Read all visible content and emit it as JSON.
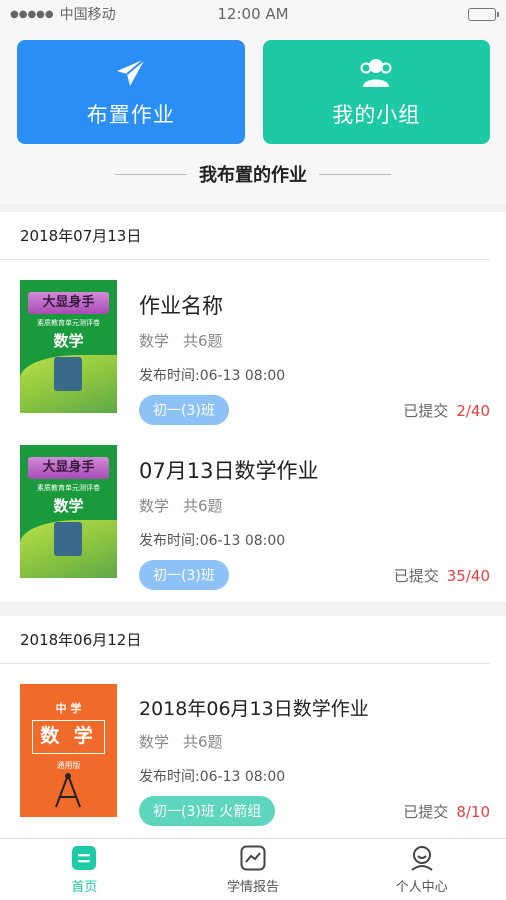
{
  "status_bar": {
    "signal": "●●●●●",
    "carrier": "中国移动",
    "time": "12:00 AM"
  },
  "actions": [
    {
      "label": "布置作业",
      "icon": "paper-plane-icon",
      "color": "#2a8ef5"
    },
    {
      "label": "我的小组",
      "icon": "group-icon",
      "color": "#1ec9a6"
    }
  ],
  "section_title": "我布置的作业",
  "groups": [
    {
      "date": "2018年07月13日",
      "items": [
        {
          "cover": {
            "title": "大显身手",
            "sub": "素质教育单元测评卷",
            "subject": "数学"
          },
          "name": "作业名称",
          "subject": "数学",
          "count": "共6题",
          "publish_time": "发布时间:06-13 08:00",
          "class_tag": "初一(3)班",
          "submitted_label": "已提交",
          "submitted": "2/40"
        },
        {
          "cover": {
            "title": "大显身手",
            "sub": "素质教育单元测评卷",
            "subject": "数学"
          },
          "name": "07月13日数学作业",
          "subject": "数学",
          "count": "共6题",
          "publish_time": "发布时间:06-13 08:00",
          "class_tag": "初一(3)班",
          "submitted_label": "已提交",
          "submitted": "35/40"
        }
      ]
    },
    {
      "date": "2018年06月12日",
      "items": [
        {
          "cover": {
            "top": "中 学",
            "subject": "数 学",
            "edition": "通用版"
          },
          "name": "2018年06月13日数学作业",
          "subject": "数学",
          "count": "共6题",
          "publish_time": "发布时间:06-13 08:00",
          "class_tag": "初一(3)班 火箭组",
          "submitted_label": "已提交",
          "submitted": "8/10"
        }
      ]
    }
  ],
  "tabs": [
    {
      "label": "首页",
      "icon": "home-icon",
      "active": true
    },
    {
      "label": "学情报告",
      "icon": "report-chart-icon",
      "active": false
    },
    {
      "label": "个人中心",
      "icon": "profile-icon",
      "active": false
    }
  ],
  "colors": {
    "accent": "#1ec9a6",
    "primary": "#2a8ef5",
    "alert": "#e84040"
  }
}
